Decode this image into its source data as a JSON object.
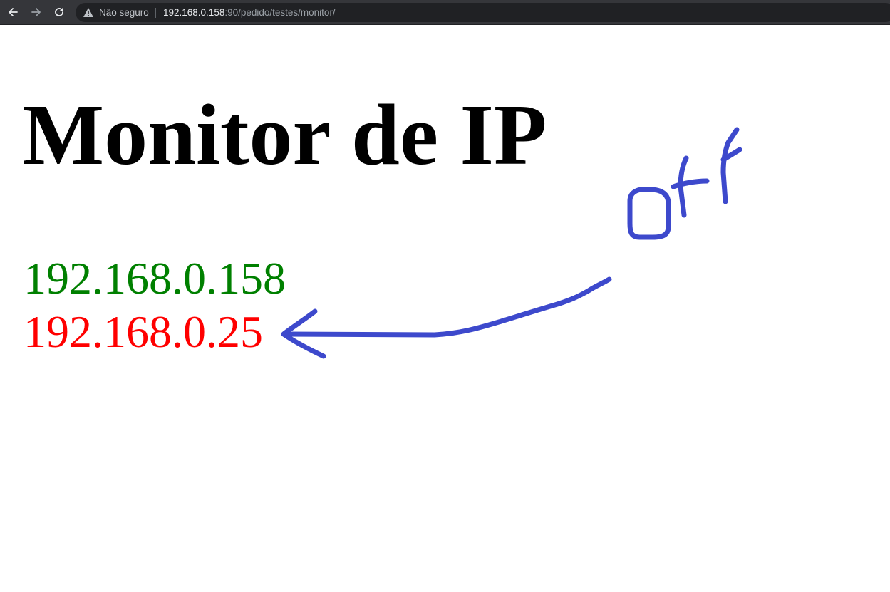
{
  "browser": {
    "security_label": "Não seguro",
    "url_host": "192.168.0.158",
    "url_rest": ":90/pedido/testes/monitor/"
  },
  "page": {
    "title": "Monitor de IP",
    "ips": [
      {
        "address": "192.168.0.158",
        "status": "online",
        "color": "#008000"
      },
      {
        "address": "192.168.0.25",
        "status": "offline",
        "color": "#ff0000"
      }
    ]
  },
  "annotation": {
    "text": "OFF",
    "color": "#3d49cc"
  }
}
